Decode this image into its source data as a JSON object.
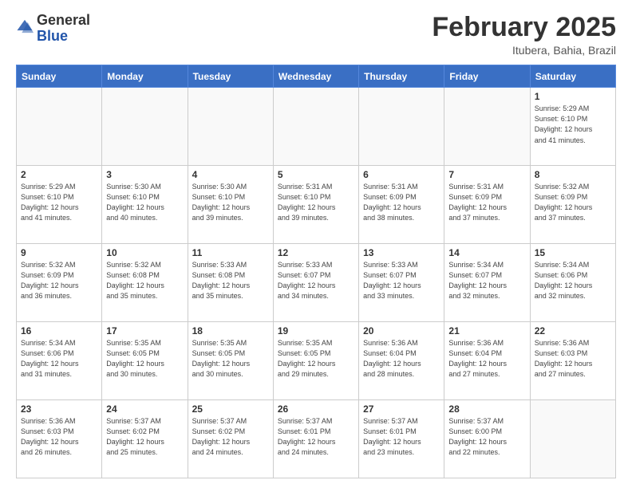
{
  "header": {
    "logo_general": "General",
    "logo_blue": "Blue",
    "month_title": "February 2025",
    "location": "Itubera, Bahia, Brazil"
  },
  "days_of_week": [
    "Sunday",
    "Monday",
    "Tuesday",
    "Wednesday",
    "Thursday",
    "Friday",
    "Saturday"
  ],
  "weeks": [
    [
      {
        "day": "",
        "info": ""
      },
      {
        "day": "",
        "info": ""
      },
      {
        "day": "",
        "info": ""
      },
      {
        "day": "",
        "info": ""
      },
      {
        "day": "",
        "info": ""
      },
      {
        "day": "",
        "info": ""
      },
      {
        "day": "1",
        "info": "Sunrise: 5:29 AM\nSunset: 6:10 PM\nDaylight: 12 hours\nand 41 minutes."
      }
    ],
    [
      {
        "day": "2",
        "info": "Sunrise: 5:29 AM\nSunset: 6:10 PM\nDaylight: 12 hours\nand 41 minutes."
      },
      {
        "day": "3",
        "info": "Sunrise: 5:30 AM\nSunset: 6:10 PM\nDaylight: 12 hours\nand 40 minutes."
      },
      {
        "day": "4",
        "info": "Sunrise: 5:30 AM\nSunset: 6:10 PM\nDaylight: 12 hours\nand 39 minutes."
      },
      {
        "day": "5",
        "info": "Sunrise: 5:31 AM\nSunset: 6:10 PM\nDaylight: 12 hours\nand 39 minutes."
      },
      {
        "day": "6",
        "info": "Sunrise: 5:31 AM\nSunset: 6:09 PM\nDaylight: 12 hours\nand 38 minutes."
      },
      {
        "day": "7",
        "info": "Sunrise: 5:31 AM\nSunset: 6:09 PM\nDaylight: 12 hours\nand 37 minutes."
      },
      {
        "day": "8",
        "info": "Sunrise: 5:32 AM\nSunset: 6:09 PM\nDaylight: 12 hours\nand 37 minutes."
      }
    ],
    [
      {
        "day": "9",
        "info": "Sunrise: 5:32 AM\nSunset: 6:09 PM\nDaylight: 12 hours\nand 36 minutes."
      },
      {
        "day": "10",
        "info": "Sunrise: 5:32 AM\nSunset: 6:08 PM\nDaylight: 12 hours\nand 35 minutes."
      },
      {
        "day": "11",
        "info": "Sunrise: 5:33 AM\nSunset: 6:08 PM\nDaylight: 12 hours\nand 35 minutes."
      },
      {
        "day": "12",
        "info": "Sunrise: 5:33 AM\nSunset: 6:07 PM\nDaylight: 12 hours\nand 34 minutes."
      },
      {
        "day": "13",
        "info": "Sunrise: 5:33 AM\nSunset: 6:07 PM\nDaylight: 12 hours\nand 33 minutes."
      },
      {
        "day": "14",
        "info": "Sunrise: 5:34 AM\nSunset: 6:07 PM\nDaylight: 12 hours\nand 32 minutes."
      },
      {
        "day": "15",
        "info": "Sunrise: 5:34 AM\nSunset: 6:06 PM\nDaylight: 12 hours\nand 32 minutes."
      }
    ],
    [
      {
        "day": "16",
        "info": "Sunrise: 5:34 AM\nSunset: 6:06 PM\nDaylight: 12 hours\nand 31 minutes."
      },
      {
        "day": "17",
        "info": "Sunrise: 5:35 AM\nSunset: 6:05 PM\nDaylight: 12 hours\nand 30 minutes."
      },
      {
        "day": "18",
        "info": "Sunrise: 5:35 AM\nSunset: 6:05 PM\nDaylight: 12 hours\nand 30 minutes."
      },
      {
        "day": "19",
        "info": "Sunrise: 5:35 AM\nSunset: 6:05 PM\nDaylight: 12 hours\nand 29 minutes."
      },
      {
        "day": "20",
        "info": "Sunrise: 5:36 AM\nSunset: 6:04 PM\nDaylight: 12 hours\nand 28 minutes."
      },
      {
        "day": "21",
        "info": "Sunrise: 5:36 AM\nSunset: 6:04 PM\nDaylight: 12 hours\nand 27 minutes."
      },
      {
        "day": "22",
        "info": "Sunrise: 5:36 AM\nSunset: 6:03 PM\nDaylight: 12 hours\nand 27 minutes."
      }
    ],
    [
      {
        "day": "23",
        "info": "Sunrise: 5:36 AM\nSunset: 6:03 PM\nDaylight: 12 hours\nand 26 minutes."
      },
      {
        "day": "24",
        "info": "Sunrise: 5:37 AM\nSunset: 6:02 PM\nDaylight: 12 hours\nand 25 minutes."
      },
      {
        "day": "25",
        "info": "Sunrise: 5:37 AM\nSunset: 6:02 PM\nDaylight: 12 hours\nand 24 minutes."
      },
      {
        "day": "26",
        "info": "Sunrise: 5:37 AM\nSunset: 6:01 PM\nDaylight: 12 hours\nand 24 minutes."
      },
      {
        "day": "27",
        "info": "Sunrise: 5:37 AM\nSunset: 6:01 PM\nDaylight: 12 hours\nand 23 minutes."
      },
      {
        "day": "28",
        "info": "Sunrise: 5:37 AM\nSunset: 6:00 PM\nDaylight: 12 hours\nand 22 minutes."
      },
      {
        "day": "",
        "info": ""
      }
    ]
  ]
}
